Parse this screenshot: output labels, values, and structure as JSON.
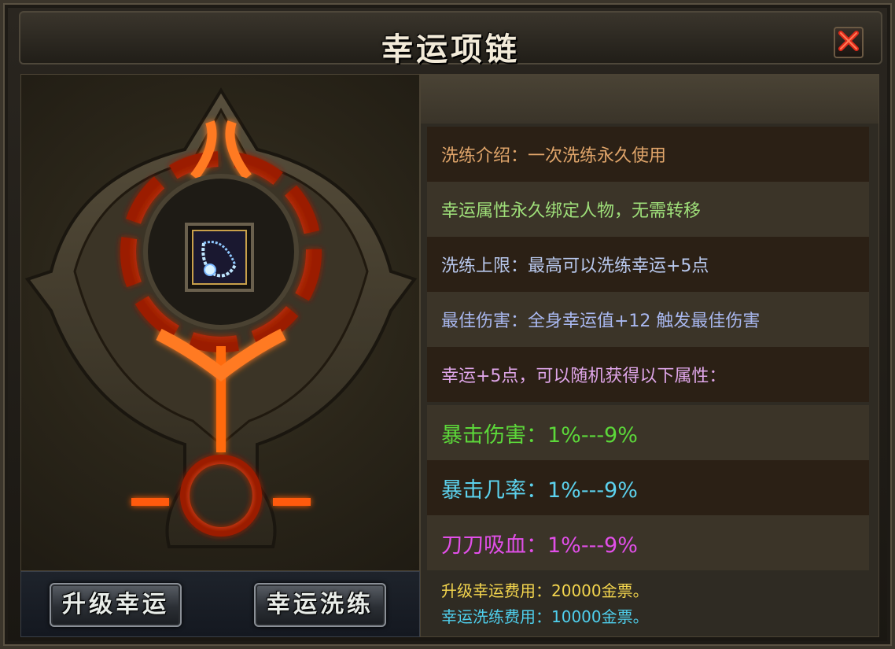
{
  "window": {
    "title": "幸运项链"
  },
  "icons": {
    "close": "close-x-icon",
    "item": "necklace-icon"
  },
  "buttons": {
    "upgrade": "升级幸运",
    "refine": "幸运洗练"
  },
  "info": {
    "rows": [
      "洗练介绍：一次洗练永久使用",
      "幸运属性永久绑定人物，无需转移",
      "洗练上限：最高可以洗练幸运+5点",
      "最佳伤害：全身幸运值+12 触发最佳伤害",
      "幸运+5点，可以随机获得以下属性："
    ],
    "attributes": [
      "暴击伤害：1%---9%",
      "暴击几率：1%---9%",
      "刀刀吸血：1%---9%"
    ],
    "costs": {
      "upgrade": "升级幸运费用：20000金票。",
      "refine": "幸运洗练费用：10000金票。"
    }
  },
  "colors": {
    "lava": "#ff6a10",
    "green": "#5cd83a",
    "cyan": "#5cd2ee",
    "magenta": "#e14fe8",
    "gold": "#f4d64e"
  }
}
